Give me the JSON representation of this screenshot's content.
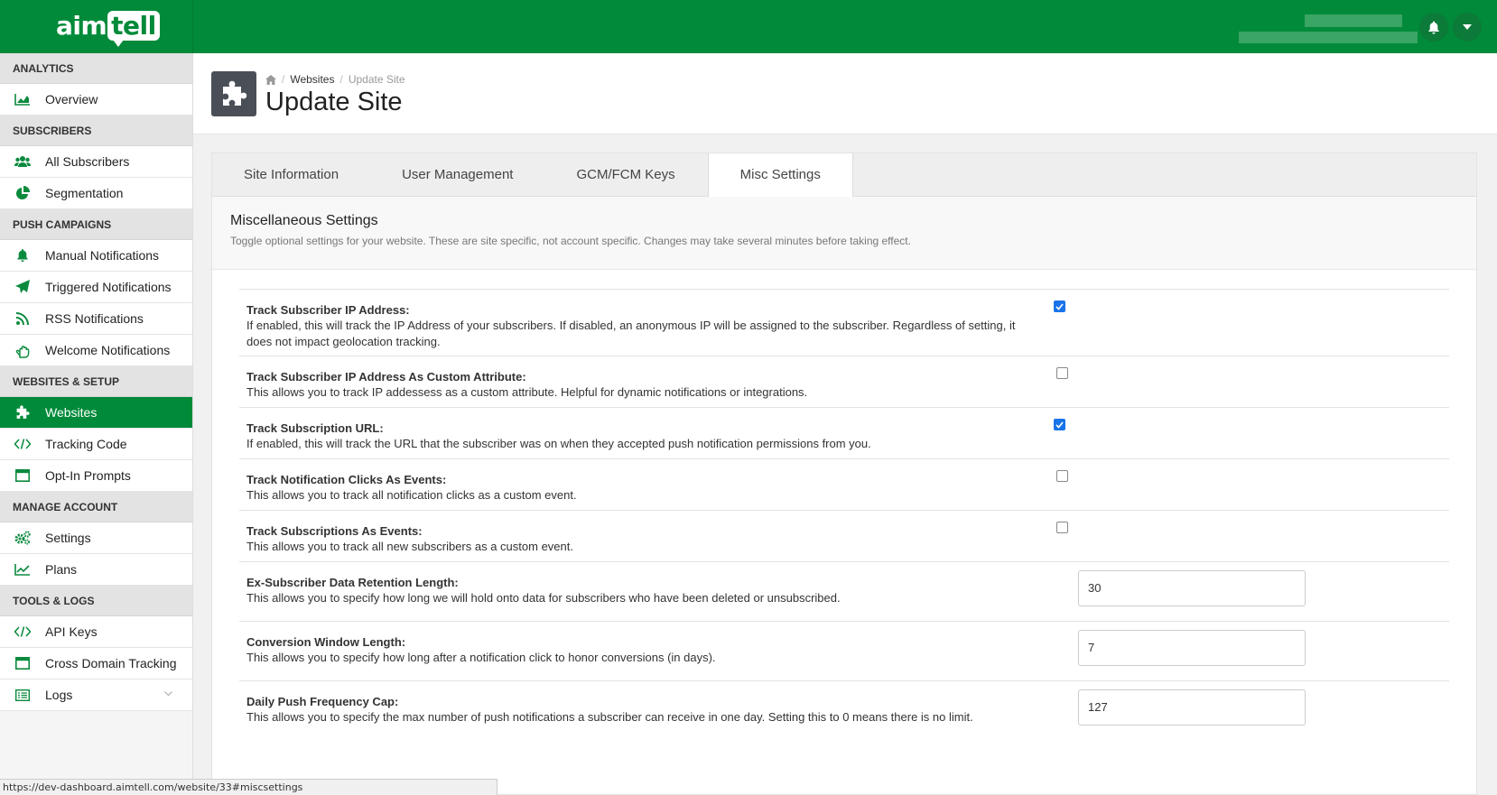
{
  "header": {
    "logo_text_a": "aim",
    "logo_text_b": "tell",
    "brand_color": "#008a39"
  },
  "sidebar": {
    "sections": [
      {
        "title": "ANALYTICS",
        "items": [
          {
            "label": "Overview",
            "icon": "area-chart-icon"
          }
        ]
      },
      {
        "title": "SUBSCRIBERS",
        "items": [
          {
            "label": "All Subscribers",
            "icon": "users-icon"
          },
          {
            "label": "Segmentation",
            "icon": "pie-chart-icon"
          }
        ]
      },
      {
        "title": "PUSH CAMPAIGNS",
        "items": [
          {
            "label": "Manual Notifications",
            "icon": "bell-icon"
          },
          {
            "label": "Triggered Notifications",
            "icon": "paper-plane-icon"
          },
          {
            "label": "RSS Notifications",
            "icon": "rss-icon"
          },
          {
            "label": "Welcome Notifications",
            "icon": "hand-wave-icon"
          }
        ]
      },
      {
        "title": "WEBSITES & SETUP",
        "items": [
          {
            "label": "Websites",
            "icon": "puzzle-icon",
            "active": true
          },
          {
            "label": "Tracking Code",
            "icon": "code-icon"
          },
          {
            "label": "Opt-In Prompts",
            "icon": "window-icon"
          }
        ]
      },
      {
        "title": "MANAGE ACCOUNT",
        "items": [
          {
            "label": "Settings",
            "icon": "cogs-icon"
          },
          {
            "label": "Plans",
            "icon": "line-chart-icon"
          }
        ]
      },
      {
        "title": "TOOLS & LOGS",
        "items": [
          {
            "label": "API Keys",
            "icon": "code-icon"
          },
          {
            "label": "Cross Domain Tracking",
            "icon": "window-icon"
          },
          {
            "label": "Logs",
            "icon": "list-icon",
            "expandable": true
          }
        ]
      }
    ]
  },
  "breadcrumb": {
    "home": "home-icon",
    "parent": "Websites",
    "current": "Update Site"
  },
  "page_title": "Update Site",
  "tabs": [
    "Site Information",
    "User Management",
    "GCM/FCM Keys",
    "Misc Settings"
  ],
  "active_tab": "Misc Settings",
  "section": {
    "title": "Miscellaneous Settings",
    "description": "Toggle optional settings for your website. These are site specific, not account specific. Changes may take several minutes before taking effect."
  },
  "settings": [
    {
      "label": "Track Subscriber IP Address:",
      "desc": "If enabled, this will track the IP Address of your subscribers. If disabled, an anonymous IP will be assigned to the subscriber. Regardless of setting, it does not impact geolocation tracking.",
      "type": "checkbox",
      "checked": true
    },
    {
      "label": "Track Subscriber IP Address As Custom Attribute:",
      "desc": "This allows you to track IP addessess as a custom attribute. Helpful for dynamic notifications or integrations.",
      "type": "checkbox",
      "checked": false
    },
    {
      "label": "Track Subscription URL:",
      "desc": "If enabled, this will track the URL that the subscriber was on when they accepted push notification permissions from you.",
      "type": "checkbox",
      "checked": true
    },
    {
      "label": "Track Notification Clicks As Events:",
      "desc": "This allows you to track all notification clicks as a custom event.",
      "type": "checkbox",
      "checked": false
    },
    {
      "label": "Track Subscriptions As Events:",
      "desc": "This allows you to track all new subscribers as a custom event.",
      "type": "checkbox",
      "checked": false
    },
    {
      "label": "Ex-Subscriber Data Retention Length:",
      "desc": "This allows you to specify how long we will hold onto data for subscribers who have been deleted or unsubscribed.",
      "type": "number",
      "value": "30"
    },
    {
      "label": "Conversion Window Length:",
      "desc": "This allows you to specify how long after a notification click to honor conversions (in days).",
      "type": "number",
      "value": "7"
    },
    {
      "label": "Daily Push Frequency Cap:",
      "desc": "This allows you to specify the max number of push notifications a subscriber can receive in one day. Setting this to 0 means there is no limit.",
      "type": "number",
      "value": "127"
    }
  ],
  "status_url": "https://dev-dashboard.aimtell.com/website/33#miscsettings"
}
